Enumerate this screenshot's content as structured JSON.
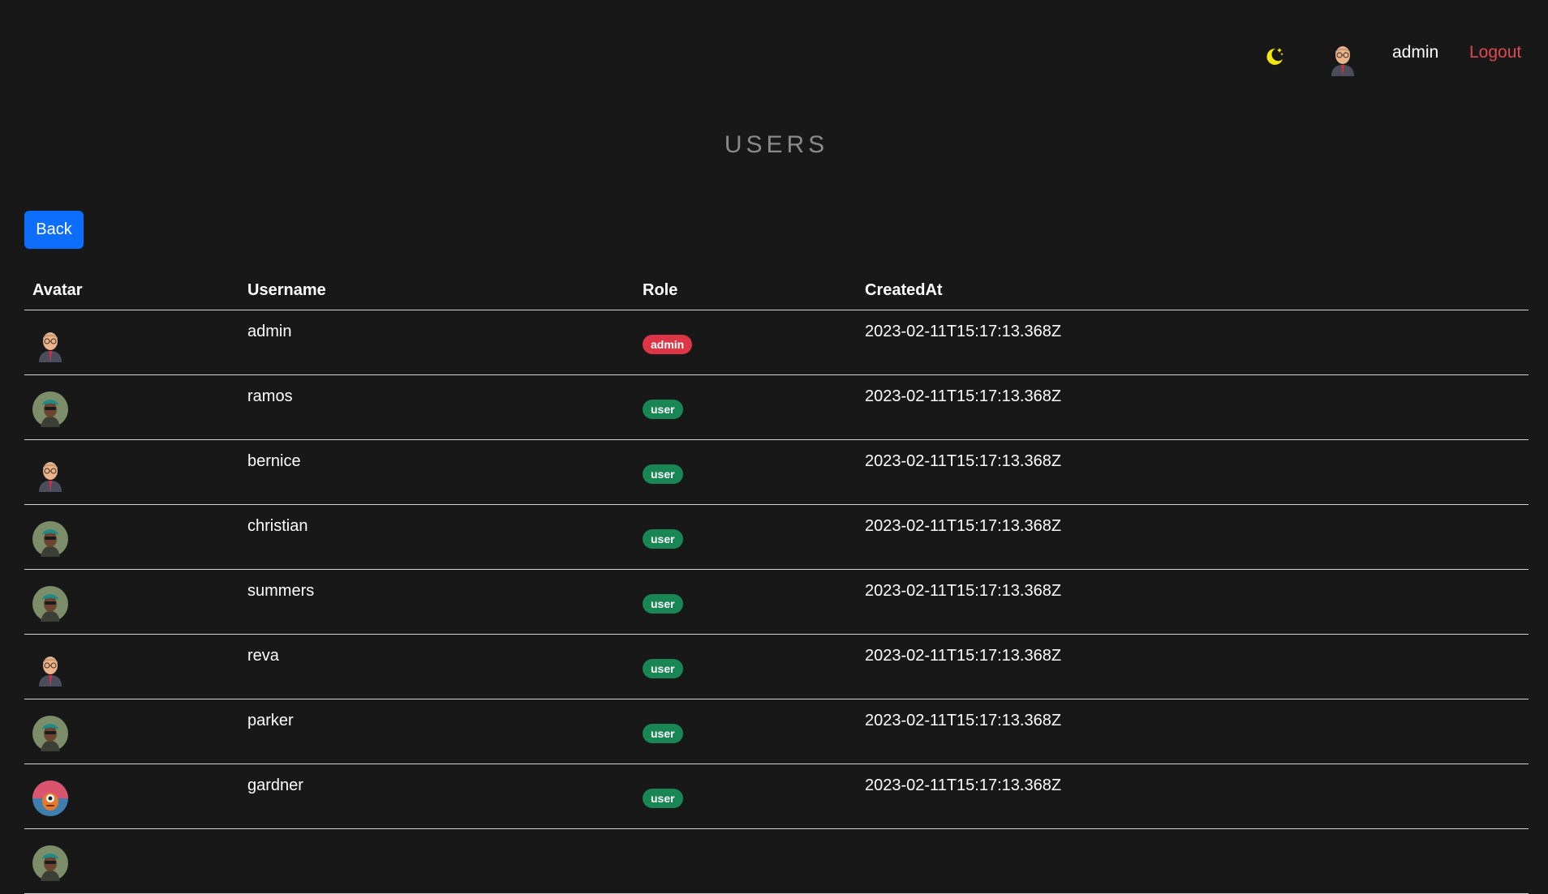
{
  "header": {
    "theme_icon": "moon-stars-icon",
    "username": "admin",
    "logout_label": "Logout",
    "colors": {
      "moon": "#f5e60a",
      "logout": "#e0474f"
    }
  },
  "page": {
    "title": "USERS",
    "back_label": "Back",
    "accent": "#0d6efd"
  },
  "table": {
    "headers": [
      "Avatar",
      "Username",
      "Role",
      "CreatedAt"
    ],
    "rows": [
      {
        "avatar": "bald-man-avatar",
        "username": "admin",
        "role": "admin",
        "created": "2023-02-11T15:17:13.368Z"
      },
      {
        "avatar": "bandana-man-avatar",
        "username": "ramos",
        "role": "user",
        "created": "2023-02-11T15:17:13.368Z"
      },
      {
        "avatar": "bald-man-avatar",
        "username": "bernice",
        "role": "user",
        "created": "2023-02-11T15:17:13.368Z"
      },
      {
        "avatar": "bandana-man-avatar",
        "username": "christian",
        "role": "user",
        "created": "2023-02-11T15:17:13.368Z"
      },
      {
        "avatar": "bandana-man-avatar",
        "username": "summers",
        "role": "user",
        "created": "2023-02-11T15:17:13.368Z"
      },
      {
        "avatar": "bald-man-avatar",
        "username": "reva",
        "role": "user",
        "created": "2023-02-11T15:17:13.368Z"
      },
      {
        "avatar": "bandana-man-avatar",
        "username": "parker",
        "role": "user",
        "created": "2023-02-11T15:17:13.368Z"
      },
      {
        "avatar": "monster-avatar",
        "username": "gardner",
        "role": "user",
        "created": "2023-02-11T15:17:13.368Z"
      },
      {
        "avatar": "bandana-man-avatar",
        "username": "",
        "role": "",
        "created": ""
      }
    ],
    "role_colors": {
      "admin": "#dc3545",
      "user": "#198754"
    }
  }
}
